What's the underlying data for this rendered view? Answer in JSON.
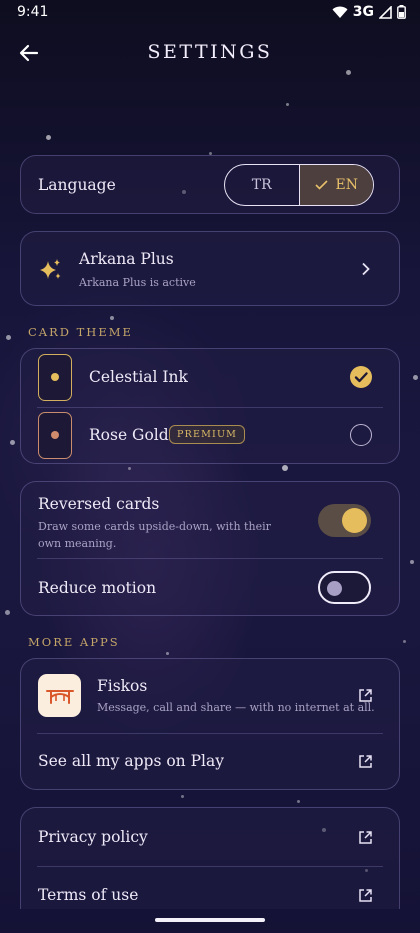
{
  "status_bar": {
    "time": "9:41",
    "network": "3G"
  },
  "header": {
    "title": "SETTINGS"
  },
  "language": {
    "label": "Language",
    "options": [
      "TR",
      "EN"
    ],
    "selected": "EN"
  },
  "plus": {
    "title": "Arkana Plus",
    "subtitle": "Arkana Plus is active"
  },
  "card_theme": {
    "section_label": "CARD THEME",
    "options": [
      {
        "name": "Celestial Ink",
        "dot_color": "#e6bd5c",
        "selected": true
      },
      {
        "name": "Rose Gold",
        "dot_color": "#d08a6c",
        "badge": "PREMIUM",
        "selected": false
      }
    ]
  },
  "preferences": {
    "reversed_cards": {
      "label": "Reversed cards",
      "description": "Draw some cards upside-down, with their own meaning.",
      "enabled": true
    },
    "reduce_motion": {
      "label": "Reduce motion",
      "enabled": false
    }
  },
  "more_apps": {
    "section_label": "MORE APPS",
    "app": {
      "name": "Fiskos",
      "description": "Message, call and share — with no internet at all."
    },
    "see_all": "See all my apps on Play"
  },
  "legal": {
    "privacy": "Privacy policy",
    "terms": "Terms of use"
  },
  "colors": {
    "accent_gold": "#e6bd5c",
    "card_border": "#968cd2",
    "background": "#17153a"
  }
}
